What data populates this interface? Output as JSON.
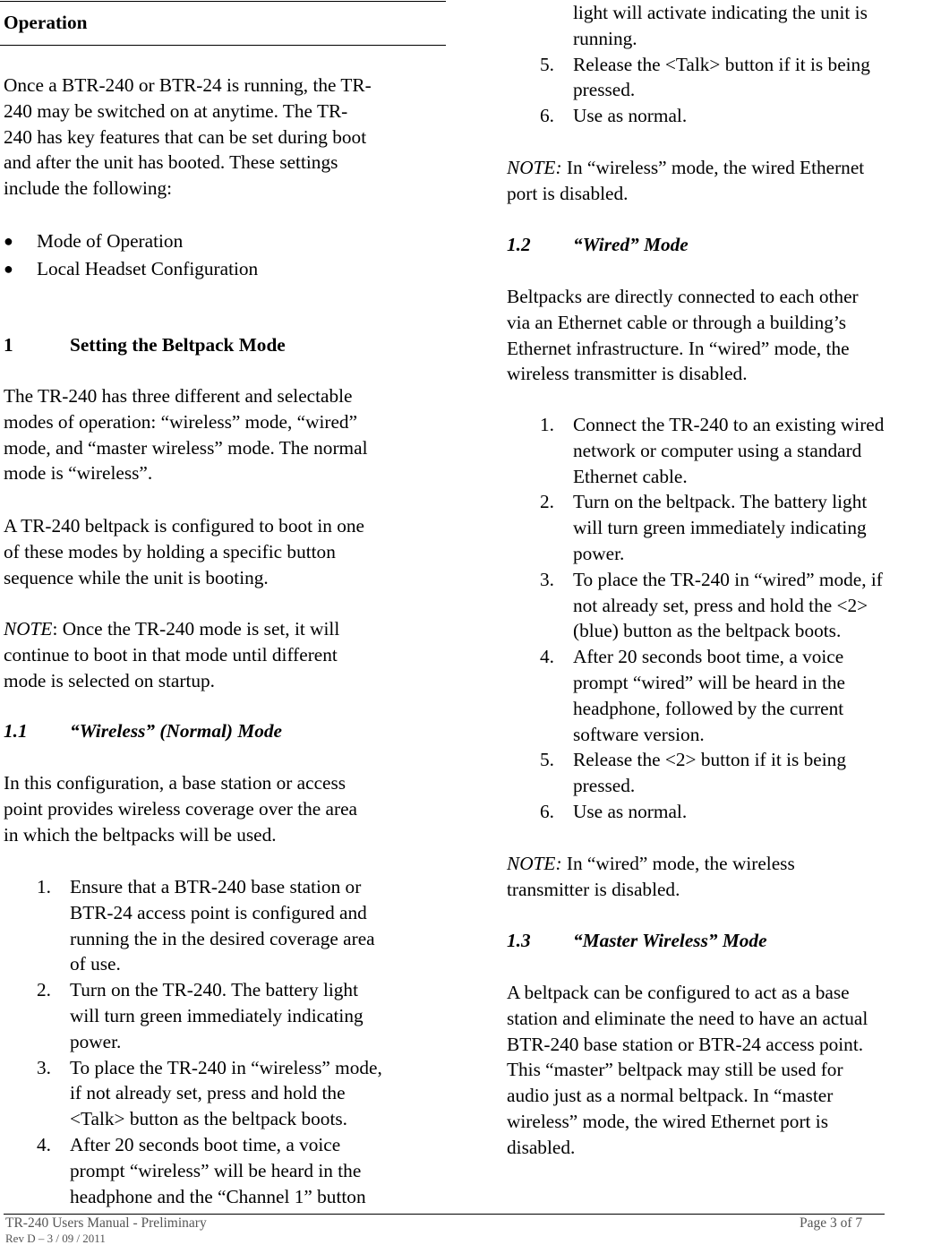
{
  "left_column": {
    "section_title": "Operation",
    "intro_lines": [
      "Once a BTR-240 or BTR-24 is running, the TR-",
      "240 may be switched on at anytime.  The TR-",
      "240 has key features that can be set during boot",
      "and after the unit has booted.  These settings",
      "include the following:"
    ],
    "bullets": [
      "Mode of Operation",
      "Local Headset Configuration"
    ],
    "heading1": {
      "number": "1",
      "title": "Setting the Beltpack Mode"
    },
    "para1_lines": [
      "The TR-240 has three different and selectable",
      "modes of operation:  “wireless” mode, “wired”",
      "mode, and “master wireless” mode.  The normal",
      "mode is “wireless”."
    ],
    "para2_lines": [
      "A TR-240 beltpack is configured to boot in one",
      "of these modes by holding a specific button",
      "sequence while the unit is booting."
    ],
    "note1": {
      "label": "NOTE",
      "lines": [
        ":  Once the TR-240 mode is set, it will",
        "continue to boot in that mode until different",
        "mode is selected on startup."
      ]
    },
    "heading1_1": {
      "number": "1.1",
      "title": "“Wireless” (Normal) Mode"
    },
    "para3_lines": [
      "In this configuration, a base station or access",
      "point provides wireless coverage over the area",
      "in which the beltpacks will be used."
    ],
    "steps": [
      {
        "num": "1.",
        "lines": [
          "Ensure that a BTR-240 base station or",
          "BTR-24 access point is configured and",
          "running the in the desired coverage area",
          "of use."
        ]
      },
      {
        "num": "2.",
        "lines": [
          "Turn on the TR-240.  The battery light",
          "will turn green immediately indicating",
          "power."
        ]
      },
      {
        "num": "3.",
        "lines": [
          "To place the TR-240 in “wireless” mode,",
          "if not already set, press and hold the",
          "<Talk> button as the beltpack boots."
        ]
      },
      {
        "num": "4.",
        "lines": [
          "After 20 seconds boot time, a voice",
          "prompt “wireless” will be heard in the",
          "headphone and the “Channel 1” button"
        ]
      }
    ]
  },
  "right_column": {
    "continued_lines": [
      "light will activate indicating the unit is",
      "running."
    ],
    "steps_cont": [
      {
        "num": "5.",
        "lines": [
          "Release the <Talk> button if it is being",
          "pressed."
        ]
      },
      {
        "num": "6.",
        "lines": [
          "Use as normal."
        ]
      }
    ],
    "note2": {
      "label": "NOTE:",
      "lines": [
        "  In “wireless” mode, the wired Ethernet",
        "port is disabled."
      ]
    },
    "heading1_2": {
      "number": "1.2",
      "title": "“Wired” Mode"
    },
    "para4_lines": [
      "Beltpacks are directly connected to each other",
      "via an Ethernet cable or through a building’s",
      "Ethernet infrastructure.  In “wired” mode, the",
      "wireless transmitter is disabled."
    ],
    "steps_wired": [
      {
        "num": "1.",
        "lines": [
          "Connect the TR-240 to an existing wired",
          "network or computer using a standard",
          "Ethernet cable."
        ]
      },
      {
        "num": "2.",
        "lines": [
          "Turn on the beltpack.  The battery light",
          "will turn green immediately indicating",
          "power."
        ]
      },
      {
        "num": "3.",
        "lines": [
          "To place the TR-240 in “wired” mode, if",
          "not already set, press and hold the <2>",
          "(blue) button as the beltpack boots."
        ]
      },
      {
        "num": "4.",
        "lines": [
          "After 20 seconds boot time, a voice",
          "prompt “wired” will be heard in the",
          "headphone, followed by the current",
          "software version."
        ]
      },
      {
        "num": "5.",
        "lines": [
          "Release the <2> button if it is being",
          "pressed."
        ]
      },
      {
        "num": "6.",
        "lines": [
          "Use as normal."
        ]
      }
    ],
    "note3": {
      "label": "NOTE:",
      "lines": [
        "  In “wired” mode, the wireless",
        "transmitter is disabled."
      ]
    },
    "heading1_3": {
      "number": "1.3",
      "title": "“Master Wireless” Mode"
    },
    "para5_lines": [
      "A beltpack can be configured to act as a base",
      "station and eliminate the need to have an actual",
      "BTR-240 base station or BTR-24 access point.",
      "This “master” beltpack may still be used for",
      "audio just as a normal beltpack.  In “master",
      "wireless” mode, the wired Ethernet port is",
      "disabled."
    ]
  },
  "footer": {
    "title": "TR-240 Users Manual - Preliminary",
    "revision": "Rev D – 3 / 09 / 2011",
    "page": "Page 3 of 7"
  }
}
